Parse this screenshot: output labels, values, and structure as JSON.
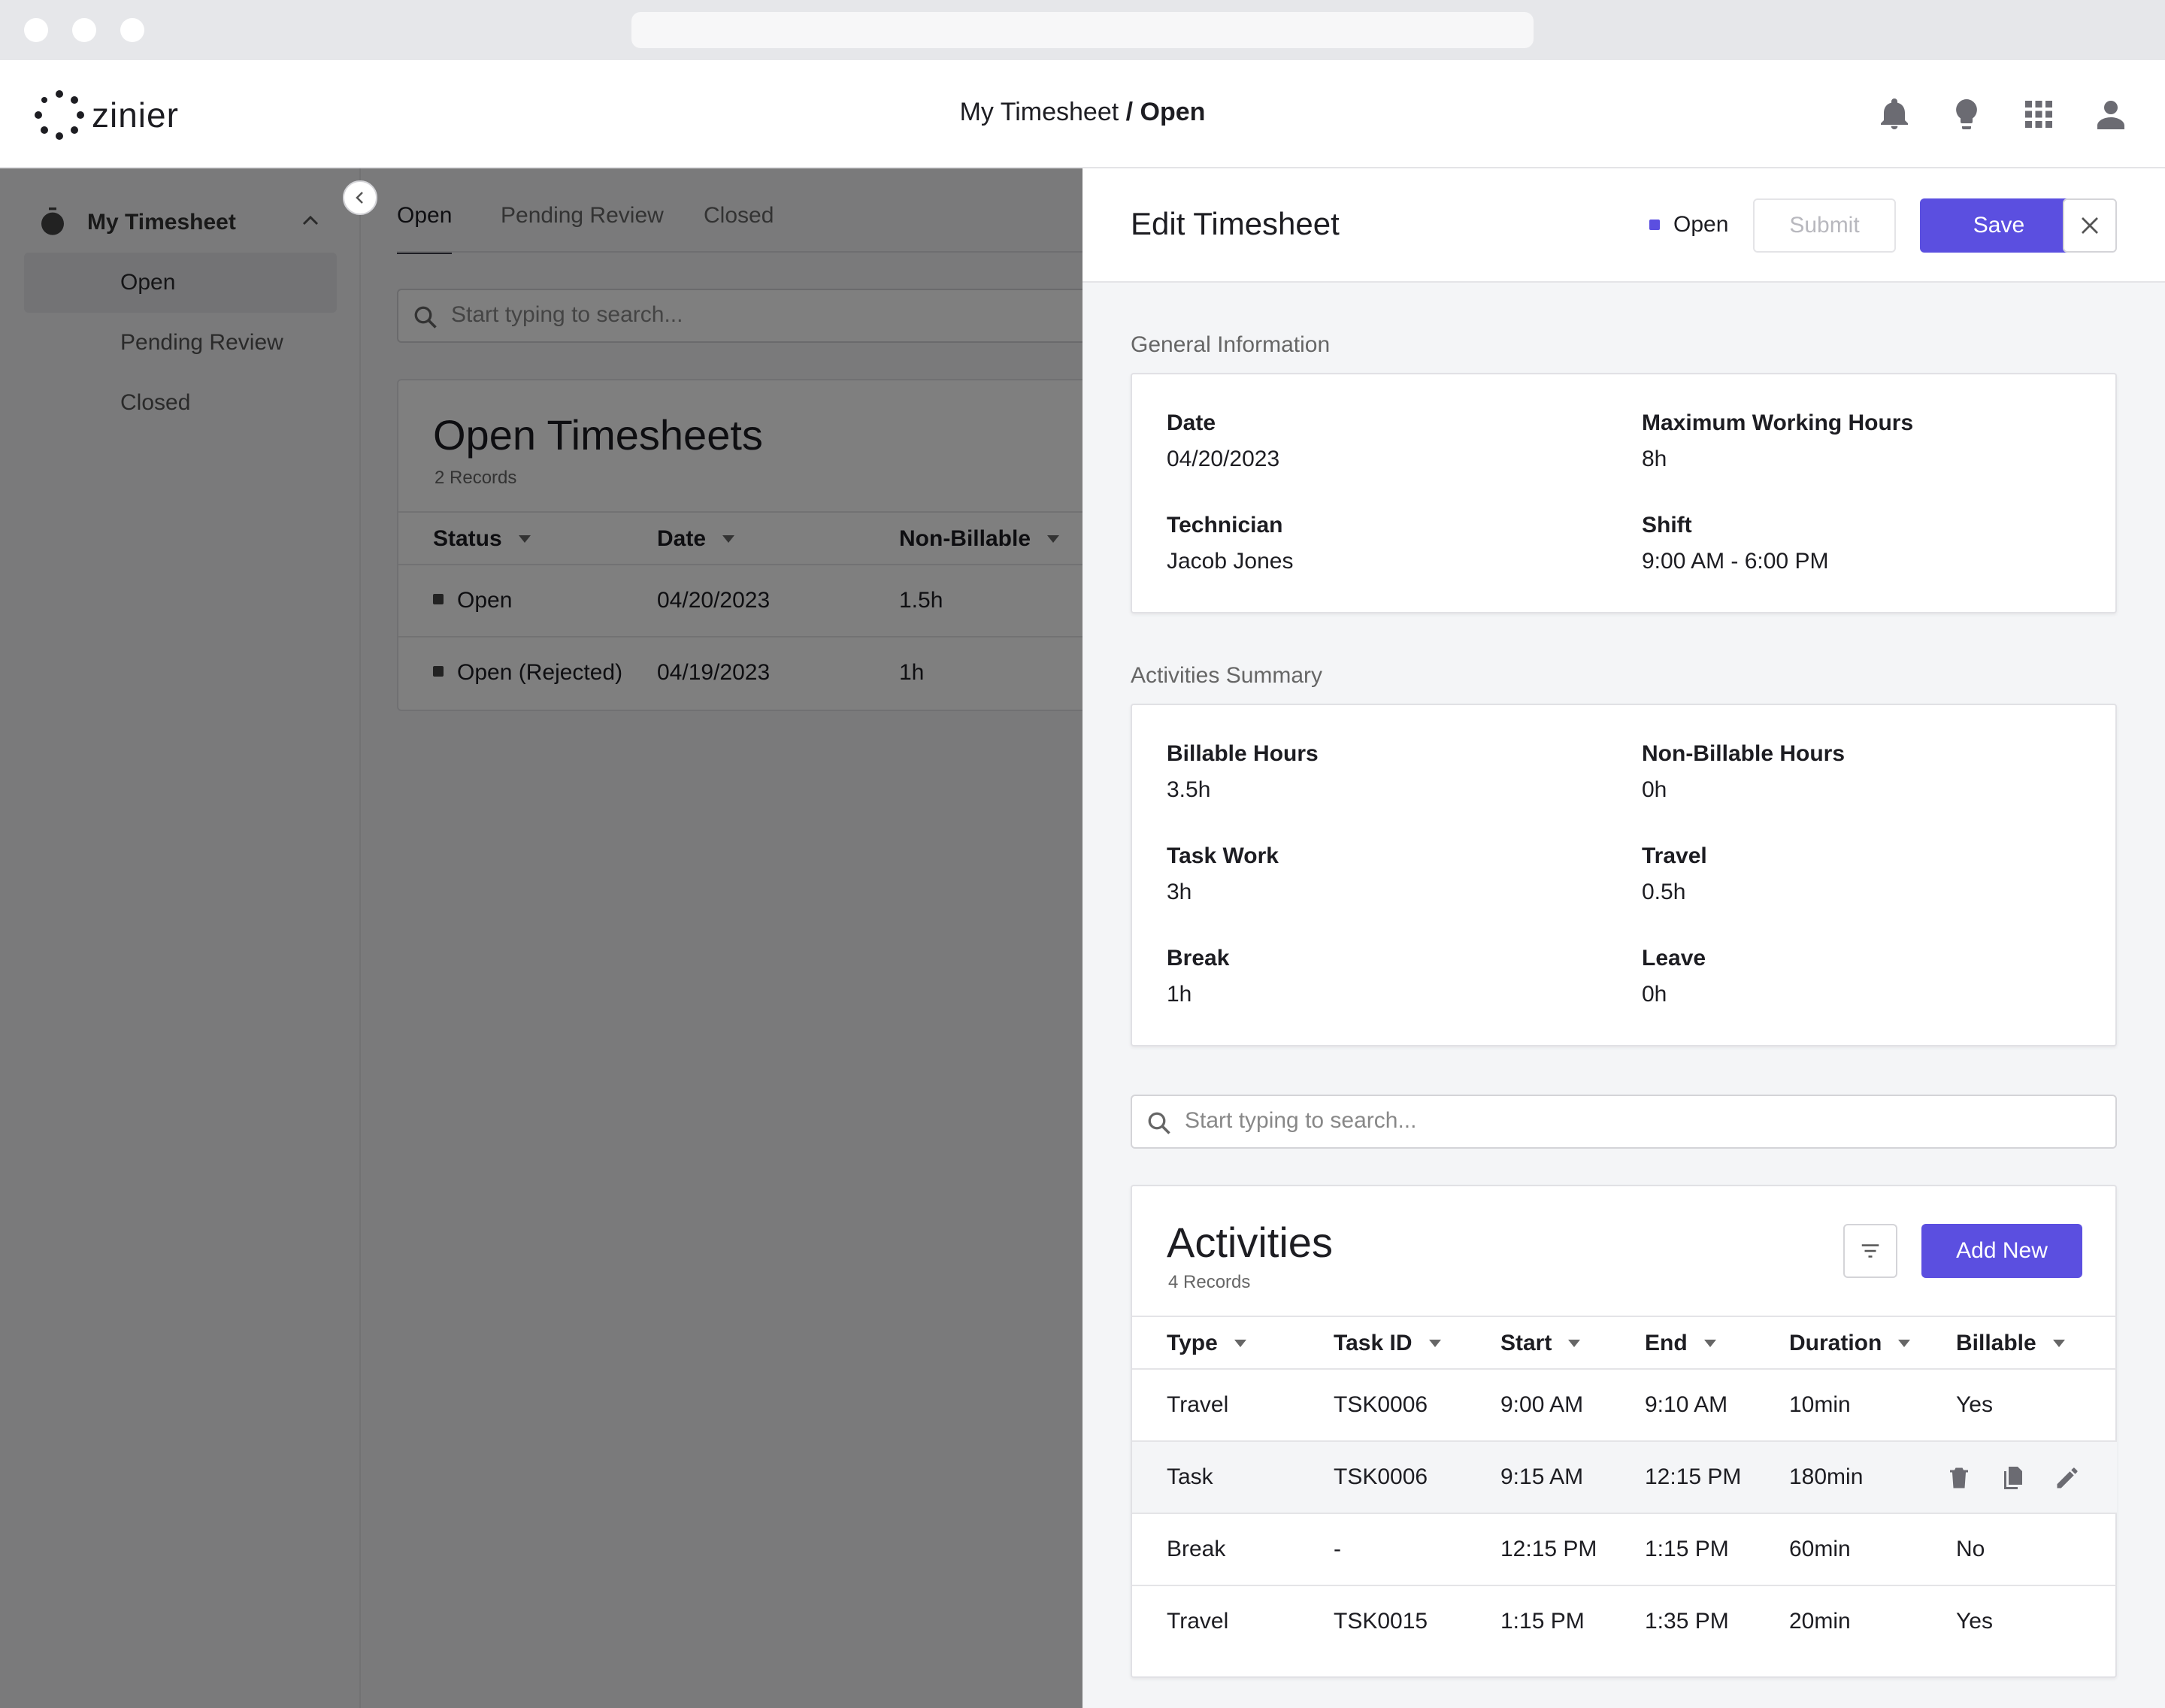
{
  "app": {
    "logo_text": "zinier",
    "breadcrumb_parent": "My Timesheet",
    "breadcrumb_separator": " / ",
    "breadcrumb_current": "Open",
    "header_icons": [
      "bell-icon",
      "lightbulb-icon",
      "apps-grid-icon",
      "user-avatar-icon"
    ]
  },
  "sidebar": {
    "section_label": "My Timesheet",
    "items": [
      {
        "label": "Open",
        "active": true
      },
      {
        "label": "Pending Review",
        "active": false
      },
      {
        "label": "Closed",
        "active": false
      }
    ]
  },
  "main": {
    "tabs": [
      {
        "label": "Open",
        "active": true
      },
      {
        "label": "Pending Review",
        "active": false
      },
      {
        "label": "Closed",
        "active": false
      }
    ],
    "search_placeholder": "Start typing to search...",
    "list_title": "Open Timesheets",
    "list_count": "2 Records",
    "columns": [
      "Status",
      "Date",
      "Non-Billable"
    ],
    "rows": [
      {
        "status": "Open",
        "date": "04/20/2023",
        "non_billable": "1.5h"
      },
      {
        "status": "Open (Rejected)",
        "date": "04/19/2023",
        "non_billable": "1h"
      }
    ]
  },
  "panel": {
    "title": "Edit Timesheet",
    "status": "Open",
    "status_color": "#5b4fe0",
    "submit_label": "Submit",
    "save_label": "Save",
    "accent_color": "#5b4fe0",
    "general": {
      "section_label": "General Information",
      "date_label": "Date",
      "date_value": "04/20/2023",
      "max_hours_label": "Maximum Working Hours",
      "max_hours_value": "8h",
      "technician_label": "Technician",
      "technician_value": "Jacob Jones",
      "shift_label": "Shift",
      "shift_value": "9:00 AM - 6:00 PM"
    },
    "summary": {
      "section_label": "Activities Summary",
      "billable_label": "Billable Hours",
      "billable_value": "3.5h",
      "non_billable_label": "Non-Billable Hours",
      "non_billable_value": "0h",
      "task_work_label": "Task Work",
      "task_work_value": "3h",
      "travel_label": "Travel",
      "travel_value": "0.5h",
      "break_label": "Break",
      "break_value": "1h",
      "leave_label": "Leave",
      "leave_value": "0h"
    },
    "search_placeholder": "Start typing to search...",
    "activities": {
      "title": "Activities",
      "count": "4 Records",
      "add_new_label": "Add New",
      "columns": [
        "Type",
        "Task ID",
        "Start",
        "End",
        "Duration",
        "Billable"
      ],
      "rows": [
        {
          "type": "Travel",
          "task_id": "TSK0006",
          "start": "9:00 AM",
          "end": "9:10 AM",
          "duration": "10min",
          "billable": "Yes"
        },
        {
          "type": "Task",
          "task_id": "TSK0006",
          "start": "9:15 AM",
          "end": "12:15 PM",
          "duration": "180min",
          "billable": ""
        },
        {
          "type": "Break",
          "task_id": "-",
          "start": "12:15 PM",
          "end": "1:15 PM",
          "duration": "60min",
          "billable": "No"
        },
        {
          "type": "Travel",
          "task_id": "TSK0015",
          "start": "1:15 PM",
          "end": "1:35 PM",
          "duration": "20min",
          "billable": "Yes"
        }
      ],
      "row_actions": [
        "trash-icon",
        "copy-icon",
        "pencil-icon"
      ]
    }
  }
}
